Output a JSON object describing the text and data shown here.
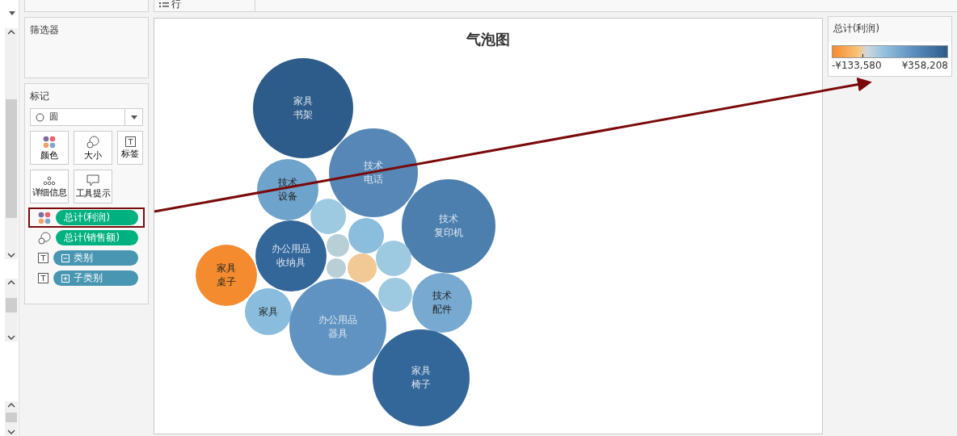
{
  "rows_shelf": {
    "label": "行"
  },
  "filters": {
    "title": "筛选器"
  },
  "marks": {
    "title": "标记",
    "mark_type": "圆",
    "cards": [
      {
        "label": "颜色",
        "kind": "color"
      },
      {
        "label": "大小",
        "kind": "size"
      },
      {
        "label": "标签",
        "kind": "text"
      },
      {
        "label": "详细信息",
        "kind": "detail"
      },
      {
        "label": "工具提示",
        "kind": "tooltip"
      }
    ],
    "pills": [
      {
        "label": "总计(利润)",
        "kind": "color",
        "color": "#00b180",
        "highlighted": true
      },
      {
        "label": "总计(销售额)",
        "kind": "size",
        "color": "#00b180",
        "highlighted": false
      },
      {
        "label": "类别",
        "kind": "text",
        "color": "#4996b2",
        "expanded": true,
        "highlighted": false
      },
      {
        "label": "子类别",
        "kind": "text",
        "color": "#4996b2",
        "expanded": false,
        "highlighted": false
      }
    ]
  },
  "chart": {
    "title": "气泡图",
    "bubbles": [
      {
        "lines": [
          "家具",
          "书架"
        ],
        "color": "#2e5c8a"
      },
      {
        "lines": [
          "技术",
          "电话"
        ],
        "color": "#5687b6"
      },
      {
        "lines": [
          "技术",
          "设备"
        ],
        "color": "#6ea3cc"
      },
      {
        "lines": [
          "技术",
          "复印机"
        ],
        "color": "#4c7fae"
      },
      {
        "color": "#9ecae1"
      },
      {
        "lines": [
          "办公用品",
          "收纳具"
        ],
        "color": "#336699"
      },
      {
        "color": "#8bbddc"
      },
      {
        "color": "#b8cfd8"
      },
      {
        "color": "#b8cfd8"
      },
      {
        "color": "#f2c994"
      },
      {
        "color": "#9ecae1"
      },
      {
        "lines": [
          "家具",
          "桌子"
        ],
        "color": "#f48b2e"
      },
      {
        "color": "#9ecae1"
      },
      {
        "lines": [
          "技术",
          "配件"
        ],
        "color": "#78a9d1"
      },
      {
        "lines": [
          "家具"
        ],
        "color": "#89bcdd"
      },
      {
        "lines": [
          "办公用品",
          "器具"
        ],
        "color": "#6093c2"
      },
      {
        "lines": [
          "家具",
          "椅子"
        ],
        "color": "#336699"
      }
    ]
  },
  "legend": {
    "title": "总计(利润)",
    "min_label": "-¥133,580",
    "max_label": "¥358,208"
  }
}
